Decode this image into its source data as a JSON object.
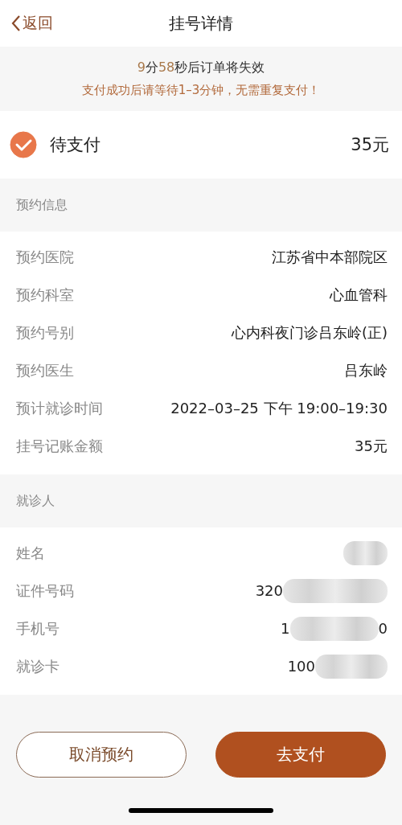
{
  "nav": {
    "back": "返回",
    "title": "挂号详情"
  },
  "notice": {
    "countdown": [
      {
        "text": "9",
        "highlight": true
      },
      {
        "text": "分",
        "highlight": false
      },
      {
        "text": "58",
        "highlight": true
      },
      {
        "text": "秒后订单将失效",
        "highlight": false
      }
    ],
    "tip": "支付成功后请等待1–3分钟，无需重复支付！"
  },
  "status": {
    "label": "待支付",
    "checked": true,
    "amount": "35元"
  },
  "sections": [
    {
      "title": "预约信息",
      "rows": [
        {
          "label": "预约医院",
          "value": "江苏省中本部院区"
        },
        {
          "label": "预约科室",
          "value": "心血管科"
        },
        {
          "label": "预约号别",
          "value": "心内科夜门诊吕东岭(正)"
        },
        {
          "label": "预约医生",
          "value": "吕东岭"
        },
        {
          "label": "预计就诊时间",
          "value": "2022–03–25 下午 19:00–19:30"
        },
        {
          "label": "挂号记账金额",
          "value": "35元"
        }
      ]
    },
    {
      "title": "就诊人",
      "rows": [
        {
          "label": "姓名",
          "redacted": true
        },
        {
          "label": "证件号码",
          "value": "320",
          "redacted": true
        },
        {
          "label": "手机号",
          "value": "1",
          "suffix": "0",
          "redacted": true
        },
        {
          "label": "就诊卡",
          "value": "100",
          "redacted": true
        }
      ]
    }
  ],
  "buttons": [
    {
      "label": "取消预约",
      "kind": "outline"
    },
    {
      "label": "去支付",
      "kind": "primary"
    }
  ]
}
